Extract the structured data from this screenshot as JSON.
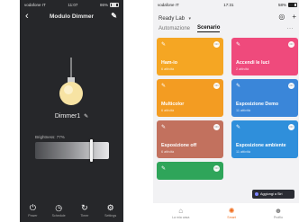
{
  "left_phone": {
    "status": {
      "carrier": "vodafone IT",
      "time": "11:07",
      "battery": "86%"
    },
    "nav": {
      "title": "Modulo Dimmer"
    },
    "device": {
      "name": "Dimmer1"
    },
    "brightness": {
      "label": "Brightness: 77%",
      "value_percent": 77
    },
    "controls": [
      {
        "label": "Power",
        "icon": "power-icon"
      },
      {
        "label": "Schedule",
        "icon": "clock-icon"
      },
      {
        "label": "Timer",
        "icon": "timer-icon"
      },
      {
        "label": "Settings",
        "icon": "gear-icon"
      }
    ]
  },
  "right_phone": {
    "status": {
      "carrier": "vodafone IT",
      "time": "17:31",
      "battery": "58%"
    },
    "home_name": "Ready Lab",
    "tabs": [
      {
        "label": "Automazione",
        "active": false
      },
      {
        "label": "Scenario",
        "active": true
      }
    ],
    "cards": [
      {
        "title": "Ham-io",
        "subtitle": "6 attività",
        "color": "#f5a623"
      },
      {
        "title": "Accendi le luci",
        "subtitle": "2 attività",
        "color": "#ef4a7c"
      },
      {
        "title": "Multicolor",
        "subtitle": "6 attività",
        "color": "#f39c22"
      },
      {
        "title": "Esposizione Demo",
        "subtitle": "11 attività",
        "color": "#3a86d9"
      },
      {
        "title": "Esposizione off",
        "subtitle": "6 attività",
        "color": "#c2715e"
      },
      {
        "title": "Esposizione ambiente",
        "subtitle": "11 attività",
        "color": "#2f8fdb"
      },
      {
        "title": "",
        "subtitle": "",
        "color": "#2fa55a"
      }
    ],
    "toast": {
      "label": "Aggiungi a Siri"
    },
    "bottom_nav": [
      {
        "label": "La mia casa",
        "icon": "home-icon",
        "active": false
      },
      {
        "label": "Smart",
        "icon": "smart-icon",
        "active": true
      },
      {
        "label": "Profilo",
        "icon": "profile-icon",
        "active": false
      }
    ],
    "accent_color": "#f06e1f"
  }
}
